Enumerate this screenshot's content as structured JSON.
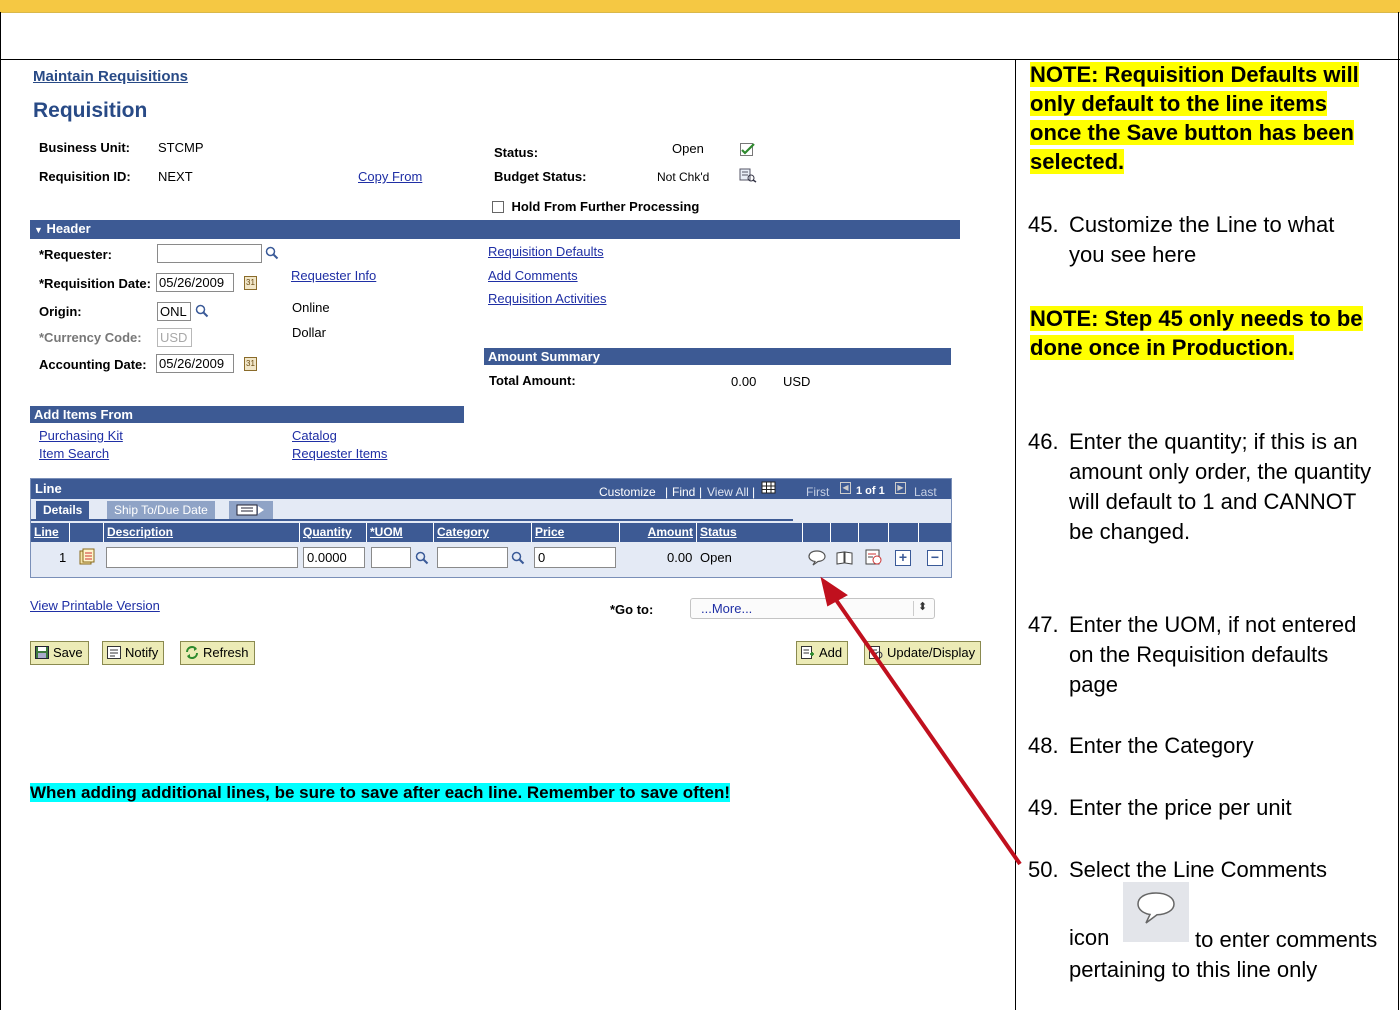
{
  "page": {
    "crumb": "Maintain Requisitions",
    "title": "Requisition",
    "business_unit_label": "Business Unit:",
    "business_unit_value": "STCMP",
    "requisition_id_label": "Requisition ID:",
    "requisition_id_value": "NEXT",
    "copy_from": "Copy From",
    "status_label": "Status:",
    "status_value": "Open",
    "budget_status_label": "Budget Status:",
    "budget_status_value": "Not Chk'd",
    "hold_label": "Hold From Further Processing"
  },
  "header": {
    "bar_label": "Header",
    "requester_label": "*Requester:",
    "requester_value": "",
    "req_date_label": "*Requisition Date:",
    "req_date_value": "05/26/2009",
    "requester_info": "Requester Info",
    "origin_label": "Origin:",
    "origin_value": "ONL",
    "origin_desc": "Online",
    "currency_label": "*Currency Code:",
    "currency_value": "USD",
    "currency_desc": "Dollar",
    "acct_date_label": "Accounting Date:",
    "acct_date_value": "05/26/2009",
    "links": [
      "Requisition Defaults",
      "Add Comments",
      "Requisition Activities"
    ]
  },
  "amount_summary": {
    "bar_label": "Amount Summary",
    "total_label": "Total Amount:",
    "total_value": "0.00",
    "currency": "USD"
  },
  "add_items": {
    "bar_label": "Add Items From",
    "links": [
      "Purchasing Kit",
      "Item Search",
      "Catalog",
      "Requester Items"
    ]
  },
  "line_grid": {
    "title": "Line",
    "customize": "Customize",
    "find": "Find",
    "view_all": "View All",
    "first": "First",
    "count": "1 of 1",
    "last": "Last",
    "tabs": [
      "Details",
      "Ship To/Due Date"
    ],
    "columns": [
      "Line",
      "Description",
      "Quantity",
      "*UOM",
      "Category",
      "Price",
      "Amount",
      "Status"
    ],
    "row": {
      "line": "1",
      "description": "",
      "quantity": "0.0000",
      "uom": "",
      "category": "",
      "price": "0",
      "amount": "0.00",
      "status": "Open"
    }
  },
  "footer": {
    "printable": "View Printable Version",
    "goto_label": "*Go to:",
    "goto_value": "...More...",
    "buttons": [
      "Save",
      "Notify",
      "Refresh"
    ],
    "right_buttons": [
      "Add",
      "Update/Display"
    ]
  },
  "callout": "When adding additional lines, be sure to save after each line.  Remember to save often!",
  "instructions": {
    "note1": "NOTE: Requisition Defaults will only default to the line items once the Save button has been selected.",
    "steps": [
      {
        "num": "45.",
        "text": "Customize the Line to what you see here"
      },
      {
        "num": "46.",
        "text": "Enter the quantity; if this is an amount only order, the quantity will default to 1 and CANNOT be changed."
      },
      {
        "num": "47.",
        "text": "Enter the UOM, if not entered on the Requisition defaults page"
      },
      {
        "num": "48.",
        "text": "Enter the Category"
      },
      {
        "num": "49.",
        "text": "Enter the price per unit"
      },
      {
        "num": "50.",
        "text": "Select the Line Comments"
      }
    ],
    "note2": "NOTE: Step 45 only needs to be done once in Production.",
    "step50_icon_word": "icon",
    "step50_rest": "to enter comments pertaining to this line only"
  },
  "colors": {
    "accent_bar": "#3d5a94",
    "frame_top": "#f5c843",
    "arrow": "#c0101e",
    "note_highlight": "#ffff00",
    "callout_highlight": "#00ffff"
  }
}
